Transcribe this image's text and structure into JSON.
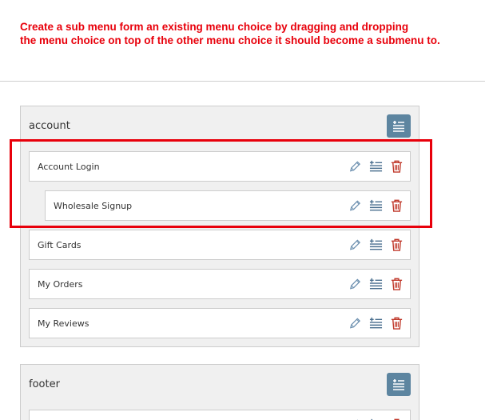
{
  "instruction": {
    "line1": "Create a sub menu form an existing menu choice by dragging and dropping",
    "line2": "the menu choice on top of the other menu choice it should become a submenu to."
  },
  "colors": {
    "instruction_text": "#e8000b",
    "highlight_border": "#e8000b",
    "add_button": "#5d85a0",
    "delete_icon": "#c0392b",
    "edit_icon": "#6a8eae"
  },
  "menus": [
    {
      "title": "account",
      "items": [
        {
          "label": "Account Login",
          "level": 0
        },
        {
          "label": "Wholesale Signup",
          "level": 1
        },
        {
          "label": "Gift Cards",
          "level": 0
        },
        {
          "label": "My Orders",
          "level": 0
        },
        {
          "label": "My Reviews",
          "level": 0
        }
      ]
    },
    {
      "title": "footer",
      "items": []
    }
  ],
  "icons": {
    "add_sub": "add-submenu-icon",
    "edit": "pencil-icon",
    "delete": "trash-icon"
  }
}
